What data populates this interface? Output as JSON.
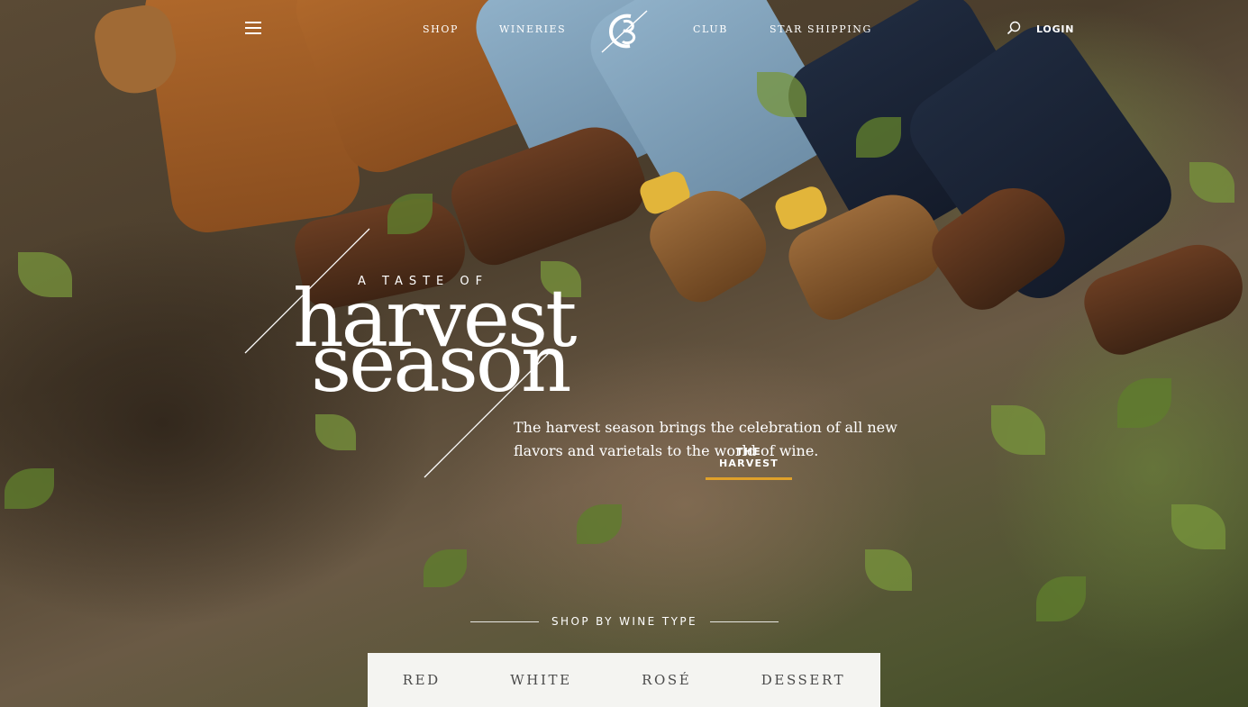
{
  "nav": {
    "menu_icon": "hamburger-icon",
    "links": [
      "SHOP",
      "WINERIES",
      "CLUB",
      "STAR SHIPPING"
    ],
    "search_icon": "search-icon",
    "login": "LOGIN"
  },
  "hero": {
    "kicker": "A TASTE OF",
    "title_line1": "harvest",
    "title_line2": "season",
    "description": "The harvest season brings the celebration of all new flavors and varietals to the world of wine.",
    "cta": "THE HARVEST",
    "accent_color": "#e0a12a"
  },
  "shop_by": {
    "heading": "SHOP BY WINE TYPE",
    "types": [
      "RED",
      "WHITE",
      "ROSÉ",
      "DESSERT"
    ]
  }
}
